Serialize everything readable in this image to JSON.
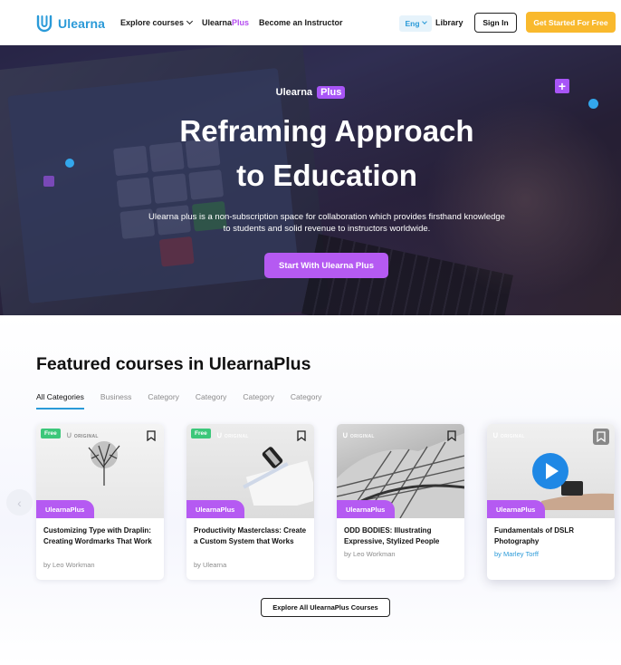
{
  "nav": {
    "logo_text": "Ulearna",
    "explore_label": "Explore courses",
    "plus_link_prefix": "Ulearna",
    "plus_link_suffix": "Plus",
    "instructor_label": "Become an Instructor",
    "lang_label": "Eng",
    "library_label": "Library",
    "signin_label": "Sign In",
    "cta_label": "Get Started For Free"
  },
  "hero": {
    "brand_prefix": "Ulearna",
    "brand_pill": "Plus",
    "title_line1": "Reframing Approach",
    "title_line2": "to Education",
    "description": "Ulearna plus is a non-subscription space for collaboration which provides firsthand knowledge to students and solid revenue to instructors worldwide.",
    "cta_label": "Start With Ulearna Plus"
  },
  "featured": {
    "title": "Featured courses in UlearnaPlus",
    "tabs": [
      "All Categories",
      "Business",
      "Category",
      "Category",
      "Category",
      "Category"
    ],
    "prev_arrow": "‹",
    "cards": [
      {
        "free": "Free",
        "original": "ORIGINAL",
        "tag": "UlearnaPlus",
        "title": "Customizing Type with Draplin: Creating Wordmarks That Work",
        "author": "by Leo Workman"
      },
      {
        "free": "Free",
        "original": "ORIGINAL",
        "tag": "UlearnaPlus",
        "title": "Productivity Masterclass: Create a Custom System that Works",
        "author": "by Ulearna"
      },
      {
        "free": "",
        "original": "ORIGINAL",
        "tag": "UlearnaPlus",
        "title": "ODD BODIES: Illustrating Expressive, Stylized People",
        "author": "by Leo Workman"
      },
      {
        "free": "",
        "original": "ORIGINAL",
        "tag": "UlearnaPlus",
        "title": "Fundamentals of DSLR Photography",
        "author": "by Marley Torff"
      }
    ],
    "explore_label": "Explore All UlearnaPlus Courses"
  },
  "colors": {
    "brand_blue": "#2a9ad8",
    "plus_purple": "#b55af2",
    "cta_yellow": "#f9b92d",
    "free_green": "#3cc77a"
  }
}
